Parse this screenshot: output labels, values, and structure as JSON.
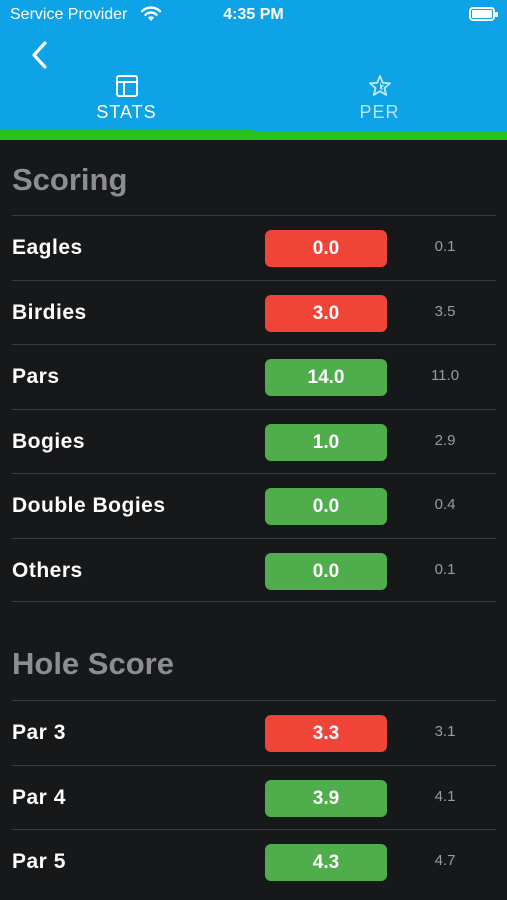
{
  "status_bar": {
    "carrier": "Service Provider",
    "time": "4:35 PM"
  },
  "nav": {
    "back_icon": "chevron-left-icon"
  },
  "tabs": [
    {
      "label": "STATS",
      "icon": "table-icon",
      "selected": true
    },
    {
      "label": "PER",
      "icon": "star-icon",
      "selected": false
    }
  ],
  "colors": {
    "accent": "#0ea3e6",
    "indicator": "#27c21a",
    "bad": "#ef4437",
    "good": "#4fad4b"
  },
  "scoring": {
    "title": "Scoring",
    "rows": [
      {
        "label": "Eagles",
        "value": "0.0",
        "avg": "0.1",
        "status": "red"
      },
      {
        "label": "Birdies",
        "value": "3.0",
        "avg": "3.5",
        "status": "red"
      },
      {
        "label": "Pars",
        "value": "14.0",
        "avg": "11.0",
        "status": "green"
      },
      {
        "label": "Bogies",
        "value": "1.0",
        "avg": "2.9",
        "status": "green"
      },
      {
        "label": "Double Bogies",
        "value": "0.0",
        "avg": "0.4",
        "status": "green"
      },
      {
        "label": "Others",
        "value": "0.0",
        "avg": "0.1",
        "status": "green"
      }
    ]
  },
  "hole_score": {
    "title": "Hole Score",
    "rows": [
      {
        "label": "Par 3",
        "value": "3.3",
        "avg": "3.1",
        "status": "red"
      },
      {
        "label": "Par 4",
        "value": "3.9",
        "avg": "4.1",
        "status": "green"
      },
      {
        "label": "Par 5",
        "value": "4.3",
        "avg": "4.7",
        "status": "green"
      }
    ]
  }
}
